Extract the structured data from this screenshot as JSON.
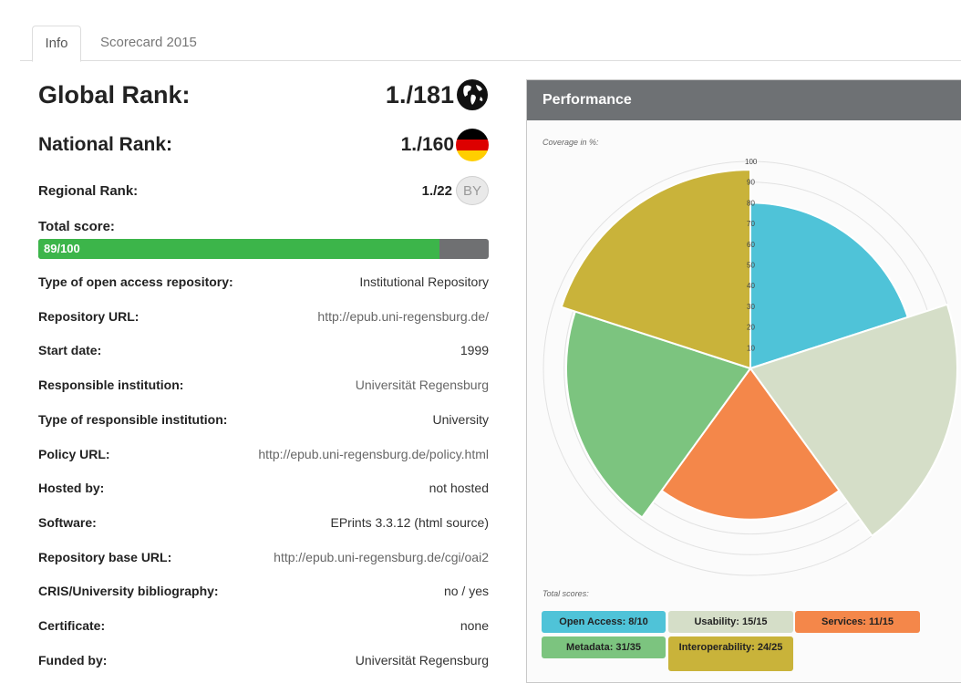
{
  "tabs": [
    {
      "label": "Info",
      "active": true
    },
    {
      "label": "Scorecard 2015",
      "active": false
    }
  ],
  "ranks": {
    "global": {
      "label": "Global Rank:",
      "value": "1./181",
      "icon": "globe-icon"
    },
    "national": {
      "label": "National Rank:",
      "value": "1./160",
      "icon": "germany-flag-icon"
    },
    "regional": {
      "label": "Regional Rank:",
      "value": "1./22",
      "badge": "BY"
    }
  },
  "total_score": {
    "label": "Total score:",
    "text": "89/100",
    "value": 89,
    "max": 100,
    "fill_color": "#3cb54a",
    "track_color": "#6f7072"
  },
  "info_rows": [
    {
      "key": "Type of open access repository:",
      "value": "Institutional Repository"
    },
    {
      "key": "Repository URL:",
      "value": "http://epub.uni-regensburg.de/"
    },
    {
      "key": "Start date:",
      "value": "1999"
    },
    {
      "key": "Responsible institution:",
      "value": "Universität Regensburg"
    },
    {
      "key": "Type of responsible institution:",
      "value": "University"
    },
    {
      "key": "Policy URL:",
      "value": "http://epub.uni-regensburg.de/policy.html"
    },
    {
      "key": "Hosted by:",
      "value": "not hosted"
    },
    {
      "key": "Software:",
      "value": "EPrints 3.3.12 (html source)"
    },
    {
      "key": "Repository base URL:",
      "value": "http://epub.uni-regensburg.de/cgi/oai2"
    },
    {
      "key": "CRIS/University bibliography:",
      "value": "no / yes"
    },
    {
      "key": "Certificate:",
      "value": "none"
    },
    {
      "key": "Funded by:",
      "value": "Universität Regensburg"
    }
  ],
  "performance": {
    "title": "Performance",
    "coverage_label": "Coverage in %:",
    "total_scores_label": "Total scores:",
    "badges": [
      {
        "text": "Open Access: 8/10",
        "color": "#4fc3d8"
      },
      {
        "text": "Usability: 15/15",
        "color": "#d5dec8"
      },
      {
        "text": "Services: 11/15",
        "color": "#f4874a"
      },
      {
        "text": "Metadata: 31/35",
        "color": "#7cc47f"
      },
      {
        "text": "Interoperability: 24/25",
        "color": "#c9b33a"
      }
    ]
  },
  "chart_data": {
    "type": "polar-area",
    "title": "",
    "scale_max": 100,
    "ticks": [
      10,
      20,
      30,
      40,
      50,
      60,
      70,
      80,
      90,
      100
    ],
    "categories": [
      "Open Access",
      "Usability",
      "Services",
      "Metadata",
      "Interoperability"
    ],
    "values": [
      80,
      100,
      73,
      89,
      96
    ],
    "colors": [
      "#4fc3d8",
      "#d5dec8",
      "#f4874a",
      "#7cc47f",
      "#c9b33a"
    ]
  }
}
